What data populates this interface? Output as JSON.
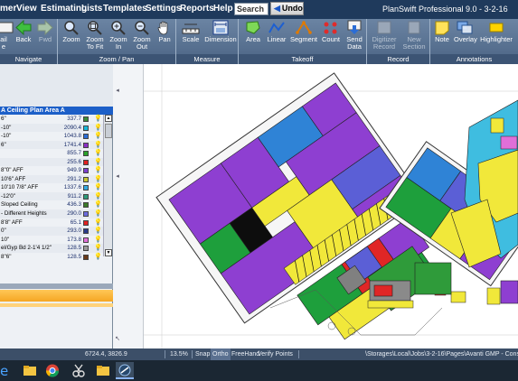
{
  "menu": {
    "items": [
      "mer",
      "View",
      "Estimating",
      "Lists",
      "Templates",
      "Settings",
      "Reports",
      "Help"
    ],
    "search_value": "Search",
    "undo_label": "Undo",
    "app_title": "PlanSwift Professional 9.0 - 3-2-16"
  },
  "ribbon": {
    "groups": [
      {
        "label": "Navigate",
        "buttons": [
          "ail\ne",
          "Back",
          "Fwd"
        ]
      },
      {
        "label": "Zoom / Pan",
        "buttons": [
          "Zoom",
          "Zoom\nTo Fit",
          "Zoom\nIn",
          "Zoom\nOut",
          "Pan"
        ]
      },
      {
        "label": "Measure",
        "buttons": [
          "Scale",
          "Dimension"
        ]
      },
      {
        "label": "Takeoff",
        "buttons": [
          "Area",
          "Linear",
          "Segment",
          "Count",
          "Send\nData"
        ]
      },
      {
        "label": "Record",
        "buttons": [
          "Digitizer\nRecord",
          "New\nSection"
        ]
      },
      {
        "label": "Annotations",
        "buttons": [
          "Note",
          "Overlay",
          "Highlighter"
        ]
      }
    ]
  },
  "takeoff_list": {
    "header": "A Ceiling Plan Area A",
    "rows": [
      {
        "name": "6\"",
        "value": "337.7",
        "color": "#3a8f3a"
      },
      {
        "name": "-10\"",
        "value": "2090.4",
        "color": "#16b6d8"
      },
      {
        "name": "-10\"",
        "value": "1043.8",
        "color": "#2b6dd6"
      },
      {
        "name": "6\"",
        "value": "1741.4",
        "color": "#8a2fc6"
      },
      {
        "name": "",
        "value": "855.7",
        "color": "#2aa12a"
      },
      {
        "name": "",
        "value": "255.6",
        "color": "#e02020"
      },
      {
        "name": "8\"0\" AFF",
        "value": "949.9",
        "color": "#7b3fcf"
      },
      {
        "name": "10'6\" AFF",
        "value": "291.2",
        "color": "#c8c830"
      },
      {
        "name": "10'10 7/8\" AFF",
        "value": "1337.6",
        "color": "#33a9e0"
      },
      {
        "name": "-12'0\"",
        "value": "911.2",
        "color": "#2c9a7a"
      },
      {
        "name": "Sloped Ceiling",
        "value": "436.3",
        "color": "#3a7a2a"
      },
      {
        "name": "- Different Heights",
        "value": "290.0",
        "color": "#6b6bdd"
      },
      {
        "name": "8'8\" AFF",
        "value": "65.1",
        "color": "#e02020"
      },
      {
        "name": "0\"",
        "value": "293.0",
        "color": "#2a3a8a"
      },
      {
        "name": "10\"",
        "value": "173.8",
        "color": "#e06fd8"
      },
      {
        "name": "el/Gyp Bd 2-1'4 1/2\"",
        "value": "128.5",
        "color": "#9a9a9a"
      },
      {
        "name": "8\"6\"",
        "value": "128.5",
        "color": "#6a3a1a"
      }
    ]
  },
  "status": {
    "coords": "6724.4, 3826.9",
    "zoom": "13.5%",
    "toggles": [
      "Snap",
      "Ortho",
      "FreeHand",
      "Verify Points"
    ],
    "path": "\\Storages\\Local\\Jobs\\3-2-16\\Pages\\Avanti GMP - Construction D"
  },
  "taskbar": {
    "apps": [
      "windows-start",
      "edge",
      "file-explorer",
      "chrome",
      "snipping-tool",
      "folder",
      "planswift"
    ]
  },
  "colors": {
    "menubar": "#1f3a5c",
    "ribbon": "#5a7394",
    "selected_header": "#1c5fc8",
    "status_bar": "#3c4f68",
    "taskbar": "#1b2733"
  }
}
